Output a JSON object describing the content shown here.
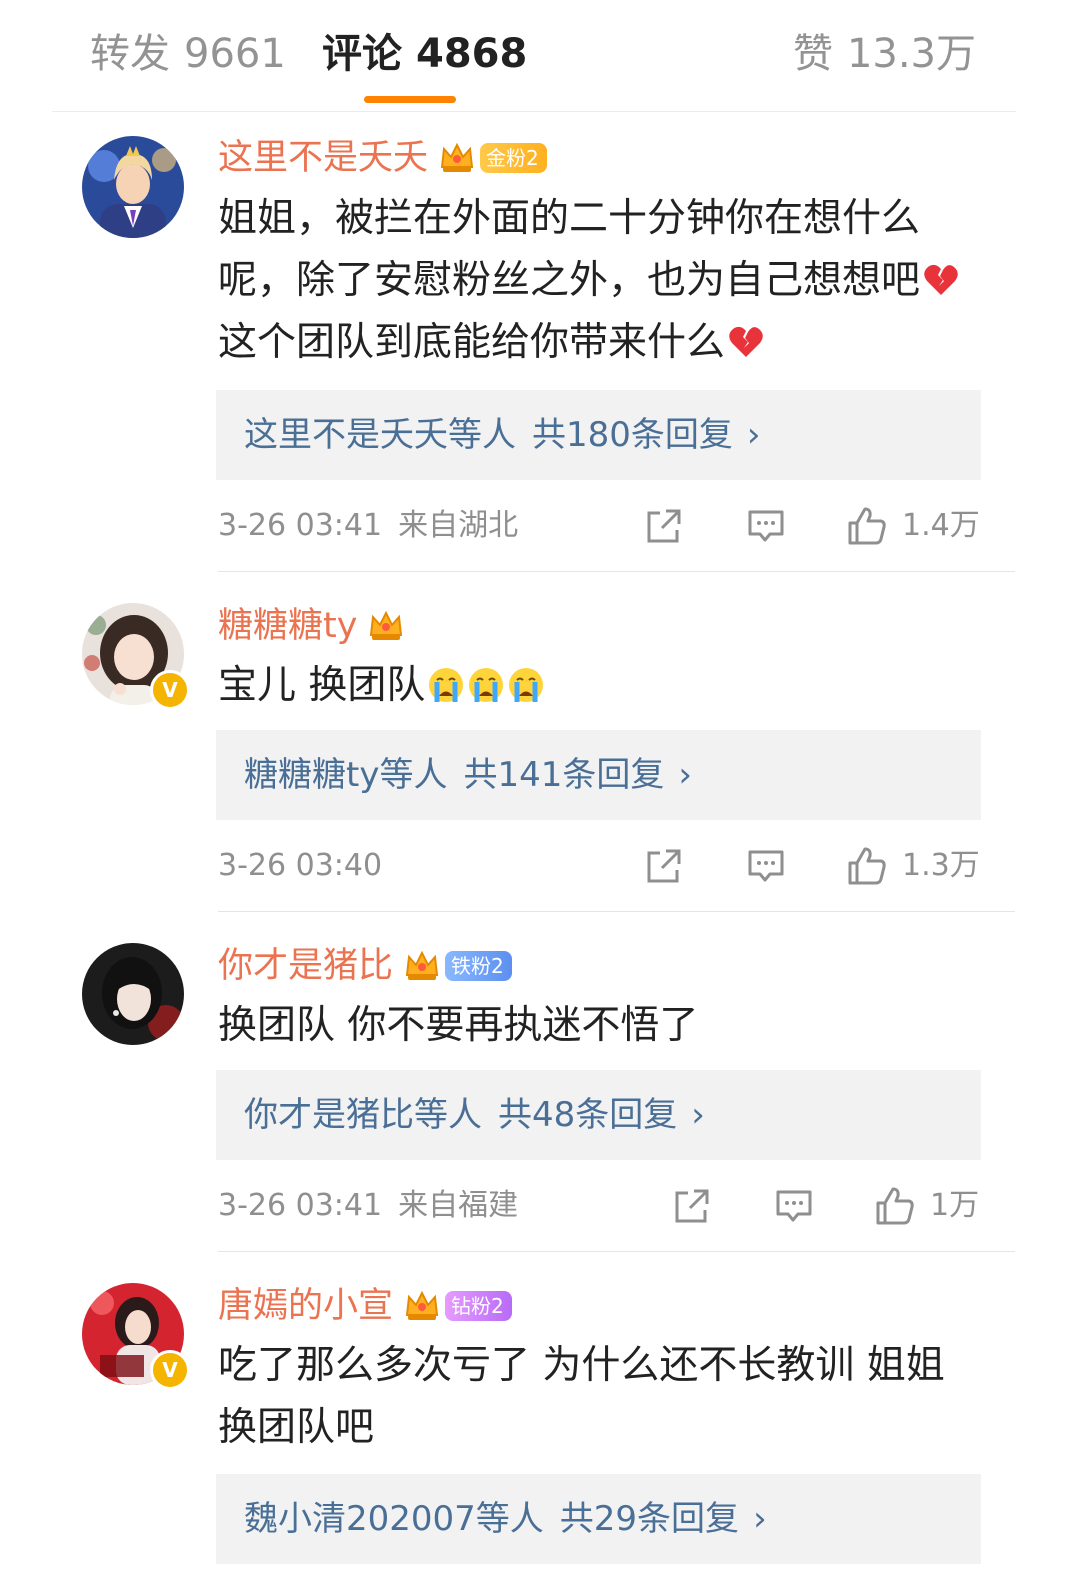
{
  "tabs": {
    "forward": {
      "label": "转发",
      "count": "9661"
    },
    "comments": {
      "label": "评论",
      "count": "4868"
    },
    "likes": {
      "label": "赞",
      "count": "13.3万"
    }
  },
  "colors": {
    "accent": "#ff8200",
    "username": "#eb7350",
    "reply_link": "#4a6f96",
    "meta": "#8f8f8f"
  },
  "comments": [
    {
      "username": "这里不是夭夭",
      "fan_badge": "金粉2",
      "text_lines": [
        "姐姐，被拦在外面的二十分钟你在想什么",
        "呢，除了安慰粉丝之外，也为自己想想吧",
        "这个团队到底能给你带来什么"
      ],
      "emoji": [
        "broken-heart-emoji",
        "broken-heart-emoji"
      ],
      "replies": {
        "who": "这里不是夭夭等人",
        "count": "共180条回复",
        "chevron": "›"
      },
      "time": "3-26 03:41",
      "location": "来自湖北",
      "likes": "1.4万"
    },
    {
      "username": "糖糖糖ty",
      "text": "宝儿 换团队",
      "emoji": [
        "crying-face-emoji",
        "crying-face-emoji",
        "crying-face-emoji"
      ],
      "verified": "V",
      "replies": {
        "who": "糖糖糖ty等人",
        "count": "共141条回复",
        "chevron": "›"
      },
      "time": "3-26 03:40",
      "likes": "1.3万"
    },
    {
      "username": "你才是猪比",
      "fan_badge": "铁粉2",
      "text": "换团队 你不要再执迷不悟了",
      "replies": {
        "who": "你才是猪比等人",
        "count": "共48条回复",
        "chevron": "›"
      },
      "time": "3-26 03:41",
      "location": "来自福建",
      "likes": "1万"
    },
    {
      "username": "唐嫣的小宣",
      "fan_badge": "钻粉2",
      "verified": "V",
      "text_lines": [
        "吃了那么多次亏了 为什么还不长教训 姐姐",
        "换团队吧"
      ],
      "replies": {
        "who": "魏小清202007等人",
        "count": "共29条回复",
        "chevron": "›"
      }
    }
  ]
}
